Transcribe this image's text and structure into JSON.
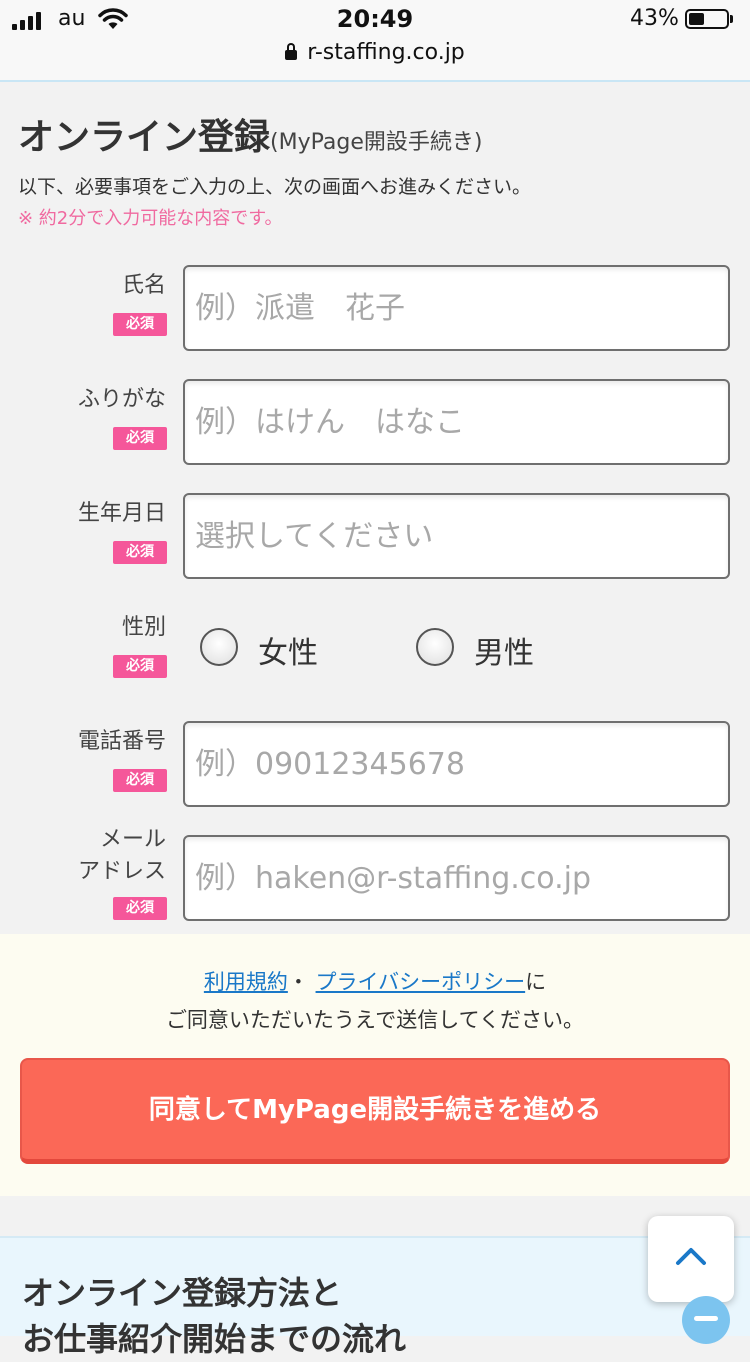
{
  "status_bar": {
    "carrier": "au",
    "time": "20:49",
    "battery": "43%",
    "battery_level": 0.43,
    "url": "r-staffing.co.jp"
  },
  "page": {
    "title": "オンライン登録",
    "title_suffix": "(MyPage開設手続き)",
    "intro": "以下、必要事項をご入力の上、次の画面へお進みください。",
    "note": "※ 約2分で入力可能な内容です。"
  },
  "form": {
    "required_badge": "必須",
    "name": {
      "label": "氏名",
      "placeholder": "例）派遣　花子",
      "value": ""
    },
    "furigana": {
      "label": "ふりがな",
      "placeholder": "例）はけん　はなこ",
      "value": ""
    },
    "birthdate": {
      "label": "生年月日",
      "placeholder": "選択してください",
      "value": ""
    },
    "gender": {
      "label": "性別",
      "options": [
        "女性",
        "男性"
      ],
      "selected": ""
    },
    "phone": {
      "label": "電話番号",
      "placeholder": "例）09012345678",
      "value": ""
    },
    "email": {
      "label_line1": "メール",
      "label_line2": "アドレス",
      "placeholder": "例）haken@r-staffing.co.jp",
      "value": ""
    }
  },
  "agreement": {
    "terms_link": "利用規約",
    "separator": "・",
    "privacy_link": "プライバシーポリシー",
    "suffix": "に",
    "line2": "ご同意いただいたうえで送信してください。",
    "submit_label": "同意してMyPage開設手続きを進める"
  },
  "flow_section": {
    "title_line1": "オンライン登録方法と",
    "title_line2": "お仕事紹介開始までの流れ"
  },
  "colors": {
    "required_badge": "#f5579a",
    "note": "#f06aa0",
    "link": "#1a78c8",
    "submit": "#fb6857"
  }
}
